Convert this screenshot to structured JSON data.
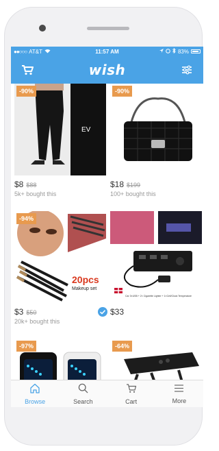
{
  "statusbar": {
    "carrier": "AT&T",
    "time": "11:57 AM",
    "battery": "83%"
  },
  "app": {
    "logo": "wish"
  },
  "colors": {
    "accent": "#4aa3e6",
    "badge": "#e89a4e"
  },
  "products": [
    {
      "discount": "-90%",
      "price": "$8",
      "old_price": "$88",
      "bought": "5k+ bought this",
      "image": "black-joggers-photo"
    },
    {
      "discount": "-90%",
      "price": "$18",
      "old_price": "$199",
      "bought": "100+ bought this",
      "image": "quilted-chain-handbag-photo"
    },
    {
      "discount": "-94%",
      "price": "$3",
      "old_price": "$50",
      "bought": "20k+ bought this",
      "image": "makeup-brush-set-photo",
      "overlay_text": "20pcs",
      "overlay_sub": "Makeup set"
    },
    {
      "discount": "",
      "price": "$33",
      "old_price": "",
      "bought": "",
      "image": "usb-car-charger-photo",
      "caption": "Car 3×USB + 2× Cigarette Lighter + 1×Cell/Clock Temperature",
      "verified": true
    },
    {
      "discount": "-97%",
      "price": "",
      "old_price": "",
      "bought": "",
      "image": "led-watches-photo"
    },
    {
      "discount": "-64%",
      "price": "",
      "old_price": "",
      "bought": "",
      "image": "laptop-table-photo"
    }
  ],
  "tabs": [
    {
      "label": "Browse",
      "icon": "home-icon",
      "active": true
    },
    {
      "label": "Search",
      "icon": "search-icon",
      "active": false
    },
    {
      "label": "Cart",
      "icon": "cart-icon",
      "active": false
    },
    {
      "label": "More",
      "icon": "menu-icon",
      "active": false
    }
  ]
}
